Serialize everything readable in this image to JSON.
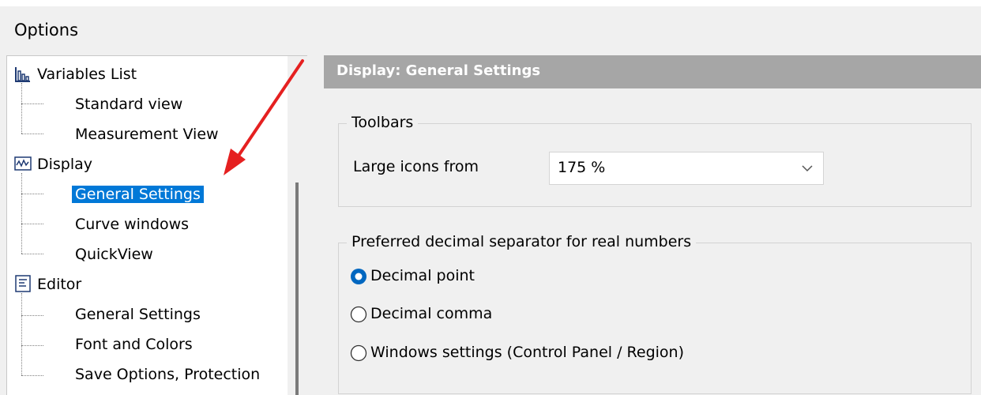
{
  "window": {
    "title": "Options"
  },
  "tree": {
    "groups": [
      {
        "label": "Variables List",
        "icon": "bar-chart-icon",
        "children": [
          "Standard view",
          "Measurement View"
        ]
      },
      {
        "label": "Display",
        "icon": "waveform-icon",
        "children": [
          "General Settings",
          "Curve windows",
          "QuickView"
        ]
      },
      {
        "label": "Editor",
        "icon": "editor-document-icon",
        "children": [
          "General Settings",
          "Font and Colors",
          "Save Options, Protection"
        ]
      }
    ],
    "selected": "Display / General Settings"
  },
  "pane": {
    "header": "Display: General Settings",
    "toolbars": {
      "legend": "Toolbars",
      "large_icons_label": "Large icons from",
      "large_icons_value": "175 %"
    },
    "decimal": {
      "legend": "Preferred decimal separator for real numbers",
      "options": [
        "Decimal point",
        "Decimal comma",
        "Windows settings (Control Panel / Region)"
      ],
      "selected_index": 0
    }
  },
  "colors": {
    "selection": "#0078d7",
    "header": "#a6a6a6",
    "arrow": "#e52020",
    "radio_accent": "#0067c0"
  }
}
